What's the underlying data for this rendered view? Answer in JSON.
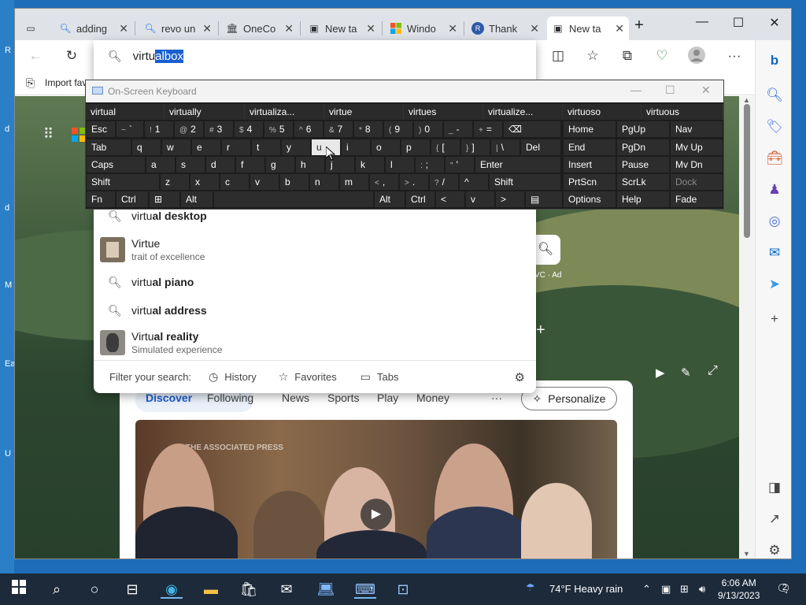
{
  "desktop_chars": [
    "R",
    "d",
    "d",
    "M",
    "Ea",
    "U"
  ],
  "tabs": [
    {
      "title": "adding",
      "icon": "search-icon"
    },
    {
      "title": "revo un",
      "icon": "search-icon"
    },
    {
      "title": "OneCo",
      "icon": "institution-icon"
    },
    {
      "title": "New ta",
      "icon": "newtab-icon"
    },
    {
      "title": "Windo",
      "icon": "windows-icon"
    },
    {
      "title": "Thank",
      "icon": "revo-icon"
    },
    {
      "title": "New ta",
      "icon": "newtab-icon",
      "active": true
    }
  ],
  "address": {
    "typed": "virtu",
    "autocomplete": "albox"
  },
  "favorites_bar": {
    "import": "Import fav"
  },
  "suggestions": [
    {
      "prefix": "virtu",
      "rest": "al desktop",
      "type": "search"
    },
    {
      "prefix": "Virtu",
      "rest": "e",
      "sub": "trait of excellence",
      "type": "entity"
    },
    {
      "prefix": "virtu",
      "rest": "al piano",
      "type": "search"
    },
    {
      "prefix": "virtu",
      "rest": "al address",
      "type": "search"
    },
    {
      "prefix": "Virtu",
      "rest": "al reality",
      "sub": "Simulated experience",
      "type": "entity"
    }
  ],
  "omni_footer": {
    "label": "Filter your search:",
    "history": "History",
    "favorites": "Favorites",
    "tabs": "Tabs"
  },
  "page": {
    "vc_ad": "VC · Ad"
  },
  "news": {
    "tabs": [
      "Discover",
      "Following",
      "News",
      "Sports",
      "Play",
      "Money"
    ],
    "more": "···",
    "personalize": "Personalize",
    "watermark": "THE ASSOCIATED PRESS"
  },
  "osk": {
    "title": "On-Screen Keyboard",
    "predictions": [
      "virtual",
      "virtually",
      "virtualiza...",
      "virtue",
      "virtues",
      "virtualize...",
      "virtuoso",
      "virtuous"
    ],
    "rows": [
      [
        [
          "Esc",
          ""
        ],
        [
          "`",
          "~"
        ],
        [
          "1",
          "!"
        ],
        [
          "2",
          "@"
        ],
        [
          "3",
          "#"
        ],
        [
          "4",
          "$"
        ],
        [
          "5",
          "%"
        ],
        [
          "6",
          "^"
        ],
        [
          "7",
          "&"
        ],
        [
          "8",
          "*"
        ],
        [
          "9",
          "("
        ],
        [
          "0",
          ")"
        ],
        [
          "-",
          "_"
        ],
        [
          "=",
          "+"
        ],
        [
          "⌫",
          ""
        ],
        [
          "Home",
          ""
        ],
        [
          "PgUp",
          ""
        ],
        [
          "Nav",
          ""
        ]
      ],
      [
        [
          "Tab",
          ""
        ],
        [
          "q",
          ""
        ],
        [
          "w",
          ""
        ],
        [
          "e",
          ""
        ],
        [
          "r",
          ""
        ],
        [
          "t",
          ""
        ],
        [
          "y",
          ""
        ],
        [
          "u",
          ""
        ],
        [
          "i",
          ""
        ],
        [
          "o",
          ""
        ],
        [
          "p",
          ""
        ],
        [
          "[",
          "{"
        ],
        [
          "]",
          "}"
        ],
        [
          "\\",
          "|"
        ],
        [
          "Del",
          ""
        ],
        [
          "End",
          ""
        ],
        [
          "PgDn",
          ""
        ],
        [
          "Mv Up",
          ""
        ]
      ],
      [
        [
          "Caps",
          ""
        ],
        [
          "a",
          ""
        ],
        [
          "s",
          ""
        ],
        [
          "d",
          ""
        ],
        [
          "f",
          ""
        ],
        [
          "g",
          ""
        ],
        [
          "h",
          ""
        ],
        [
          "j",
          ""
        ],
        [
          "k",
          ""
        ],
        [
          "l",
          ""
        ],
        [
          ";",
          ":"
        ],
        [
          "'",
          "\""
        ],
        [
          "Enter",
          ""
        ],
        [
          "Insert",
          ""
        ],
        [
          "Pause",
          ""
        ],
        [
          "Mv Dn",
          ""
        ]
      ],
      [
        [
          "Shift",
          ""
        ],
        [
          "z",
          ""
        ],
        [
          "x",
          ""
        ],
        [
          "c",
          ""
        ],
        [
          "v",
          ""
        ],
        [
          "b",
          ""
        ],
        [
          "n",
          ""
        ],
        [
          "m",
          ""
        ],
        [
          ",",
          "<"
        ],
        [
          ".",
          ">"
        ],
        [
          "/",
          "?"
        ],
        [
          "^",
          ""
        ],
        [
          "Shift",
          ""
        ],
        [
          "PrtScn",
          ""
        ],
        [
          "ScrLk",
          ""
        ],
        [
          "Dock",
          ""
        ]
      ],
      [
        [
          "Fn",
          ""
        ],
        [
          "Ctrl",
          ""
        ],
        [
          "⊞",
          ""
        ],
        [
          "Alt",
          ""
        ],
        [
          "",
          ""
        ],
        [
          "Alt",
          ""
        ],
        [
          "Ctrl",
          ""
        ],
        [
          "<",
          ""
        ],
        [
          "v",
          ""
        ],
        [
          ">",
          ""
        ],
        [
          "▤",
          ""
        ],
        [
          "Options",
          ""
        ],
        [
          "Help",
          ""
        ],
        [
          "Fade",
          ""
        ]
      ]
    ]
  },
  "taskbar": {
    "weather": "74°F  Heavy rain",
    "time": "6:06 AM",
    "date": "9/13/2023",
    "notif_count": "2"
  }
}
